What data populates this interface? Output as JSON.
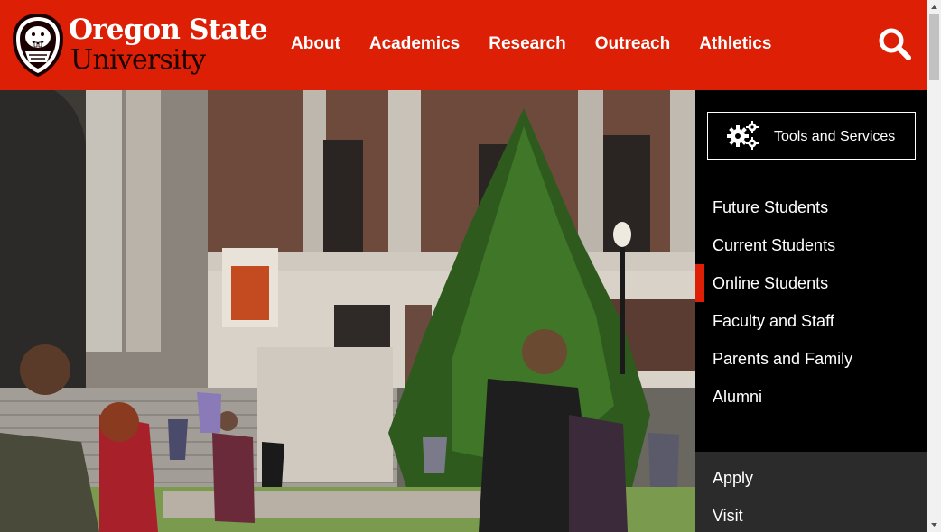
{
  "brand": {
    "line1": "Oregon State",
    "line2": "University",
    "colors": {
      "primary": "#dc1f05",
      "dark": "#000000",
      "panel_secondary": "#2b2b2b"
    }
  },
  "nav": {
    "items": [
      {
        "label": "About"
      },
      {
        "label": "Academics"
      },
      {
        "label": "Research"
      },
      {
        "label": "Outreach"
      },
      {
        "label": "Athletics"
      }
    ],
    "search_icon": "search-icon"
  },
  "panel": {
    "tools_label": "Tools and Services",
    "tools_icon": "gears-icon",
    "audiences": [
      {
        "label": "Future Students",
        "active": false
      },
      {
        "label": "Current Students",
        "active": false
      },
      {
        "label": "Online Students",
        "active": true
      },
      {
        "label": "Faculty and Staff",
        "active": false
      },
      {
        "label": "Parents and Family",
        "active": false
      },
      {
        "label": "Alumni",
        "active": false
      }
    ],
    "actions": [
      {
        "label": "Apply"
      },
      {
        "label": "Visit"
      }
    ]
  }
}
